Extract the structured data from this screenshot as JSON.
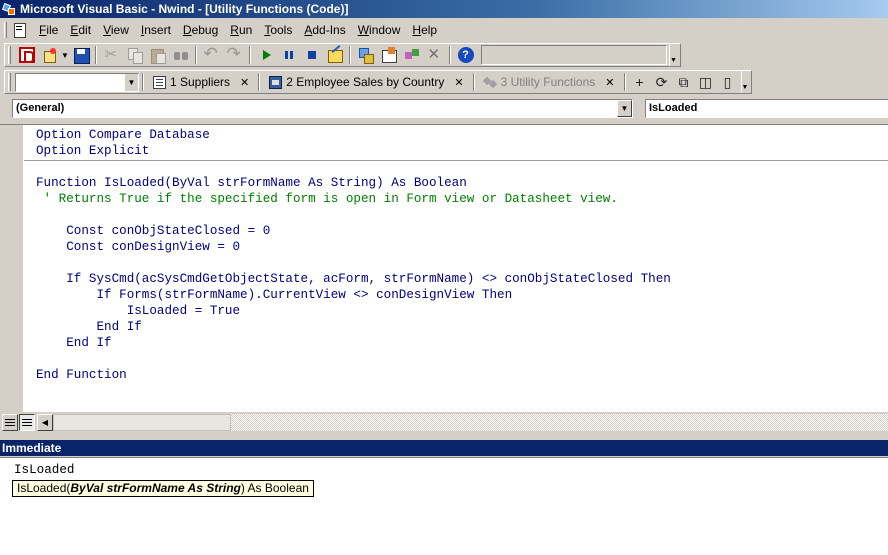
{
  "window": {
    "title": "Microsoft Visual Basic - Nwind - [Utility Functions (Code)]"
  },
  "menu": {
    "items": [
      {
        "label": "File",
        "accel": "F",
        "rest": "ile"
      },
      {
        "label": "Edit",
        "accel": "E",
        "rest": "dit"
      },
      {
        "label": "View",
        "accel": "V",
        "rest": "iew"
      },
      {
        "label": "Insert",
        "accel": "I",
        "rest": "nsert"
      },
      {
        "label": "Debug",
        "accel": "D",
        "rest": "ebug"
      },
      {
        "label": "Run",
        "accel": "R",
        "rest": "un"
      },
      {
        "label": "Tools",
        "accel": "T",
        "rest": "ools"
      },
      {
        "label": "Add-Ins",
        "accel": "A",
        "rest": "dd-Ins"
      },
      {
        "label": "Window",
        "accel": "W",
        "rest": "indow"
      },
      {
        "label": "Help",
        "accel": "H",
        "rest": "elp"
      }
    ]
  },
  "doc_tabs": [
    {
      "label": "1 Suppliers",
      "icon": "form-icon",
      "active": true
    },
    {
      "label": "2 Employee Sales by Country",
      "icon": "report-icon",
      "active": true
    },
    {
      "label": "3 Utility Functions",
      "icon": "module-icon",
      "active": false
    }
  ],
  "code_window": {
    "object_combo": "(General)",
    "procedure_combo": "IsLoaded",
    "lines": [
      {
        "text": "Option Compare Database",
        "type": "code"
      },
      {
        "text": "Option Explicit",
        "type": "code"
      },
      {
        "text": "",
        "type": "code"
      },
      {
        "text": "Function IsLoaded(ByVal strFormName As String) As Boolean",
        "type": "code"
      },
      {
        "text": " ' Returns True if the specified form is open in Form view or Datasheet view.",
        "type": "comment"
      },
      {
        "text": "",
        "type": "code"
      },
      {
        "text": "    Const conObjStateClosed = 0",
        "type": "code"
      },
      {
        "text": "    Const conDesignView = 0",
        "type": "code"
      },
      {
        "text": "",
        "type": "code"
      },
      {
        "text": "    If SysCmd(acSysCmdGetObjectState, acForm, strFormName) <> conObjStateClosed Then",
        "type": "code"
      },
      {
        "text": "        If Forms(strFormName).CurrentView <> conDesignView Then",
        "type": "code"
      },
      {
        "text": "            IsLoaded = True",
        "type": "code"
      },
      {
        "text": "        End If",
        "type": "code"
      },
      {
        "text": "    End If",
        "type": "code"
      },
      {
        "text": "",
        "type": "code"
      },
      {
        "text": "End Function",
        "type": "code"
      }
    ]
  },
  "immediate": {
    "title": "Immediate",
    "text": "IsLoaded",
    "tooltip": {
      "name": "IsLoaded(",
      "param": "ByVal strFormName As String",
      "rest": ") As Boolean"
    }
  }
}
